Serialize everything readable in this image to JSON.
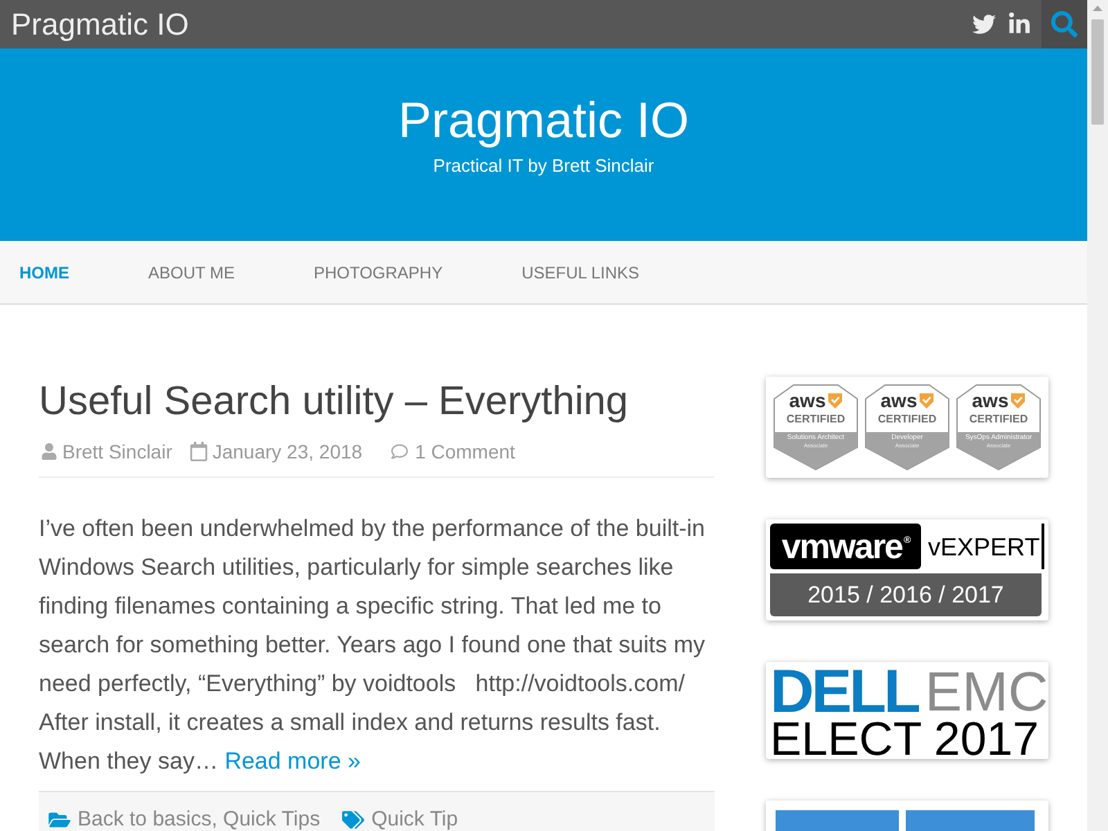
{
  "top_bar": {
    "site_name": "Pragmatic IO"
  },
  "header": {
    "title": "Pragmatic IO",
    "tagline": "Practical IT by Brett Sinclair"
  },
  "nav": {
    "items": [
      {
        "label": "HOME",
        "selected": true
      },
      {
        "label": "ABOUT ME",
        "selected": false
      },
      {
        "label": "PHOTOGRAPHY",
        "selected": false
      },
      {
        "label": "USEFUL LINKS",
        "selected": false
      }
    ]
  },
  "post": {
    "title": "Useful Search utility – Everything",
    "author": "Brett Sinclair",
    "date": "January 23, 2018",
    "comments": "1 Comment",
    "excerpt": "I’ve often been underwhelmed by the performance of the built-in Windows Search utilities, particularly for simple searches like finding filenames containing a specific string. That led me to search for something better. Years ago I found one that suits my need perfectly, “Everything” by voidtools   http://voidtools.com/ After install, it creates a small index and returns results fast. When they say…",
    "read_more": "Read more »",
    "categories": "Back to basics, Quick Tips",
    "tags": "Quick Tip"
  },
  "sidebar": {
    "widgets": [
      {
        "kind": "badges",
        "badges": [
          {
            "logo": "aws",
            "label": "CERTIFIED",
            "role": "Solutions Architect",
            "tier": "Associate"
          },
          {
            "logo": "aws",
            "label": "CERTIFIED",
            "role": "Developer",
            "tier": "Associate"
          },
          {
            "logo": "aws",
            "label": "CERTIFIED",
            "role": "SysOps Administrator",
            "tier": "Associate"
          }
        ]
      },
      {
        "kind": "vexpert",
        "logo": "vmware$^{®}$",
        "title": "vEXPERT",
        "years": "2015 / 2016 / 2017"
      },
      {
        "kind": "elect",
        "brand": "DELL",
        "brand_suffix": "EMC",
        "title": "ELECT 2017"
      },
      {
        "kind": "image"
      }
    ]
  }
}
